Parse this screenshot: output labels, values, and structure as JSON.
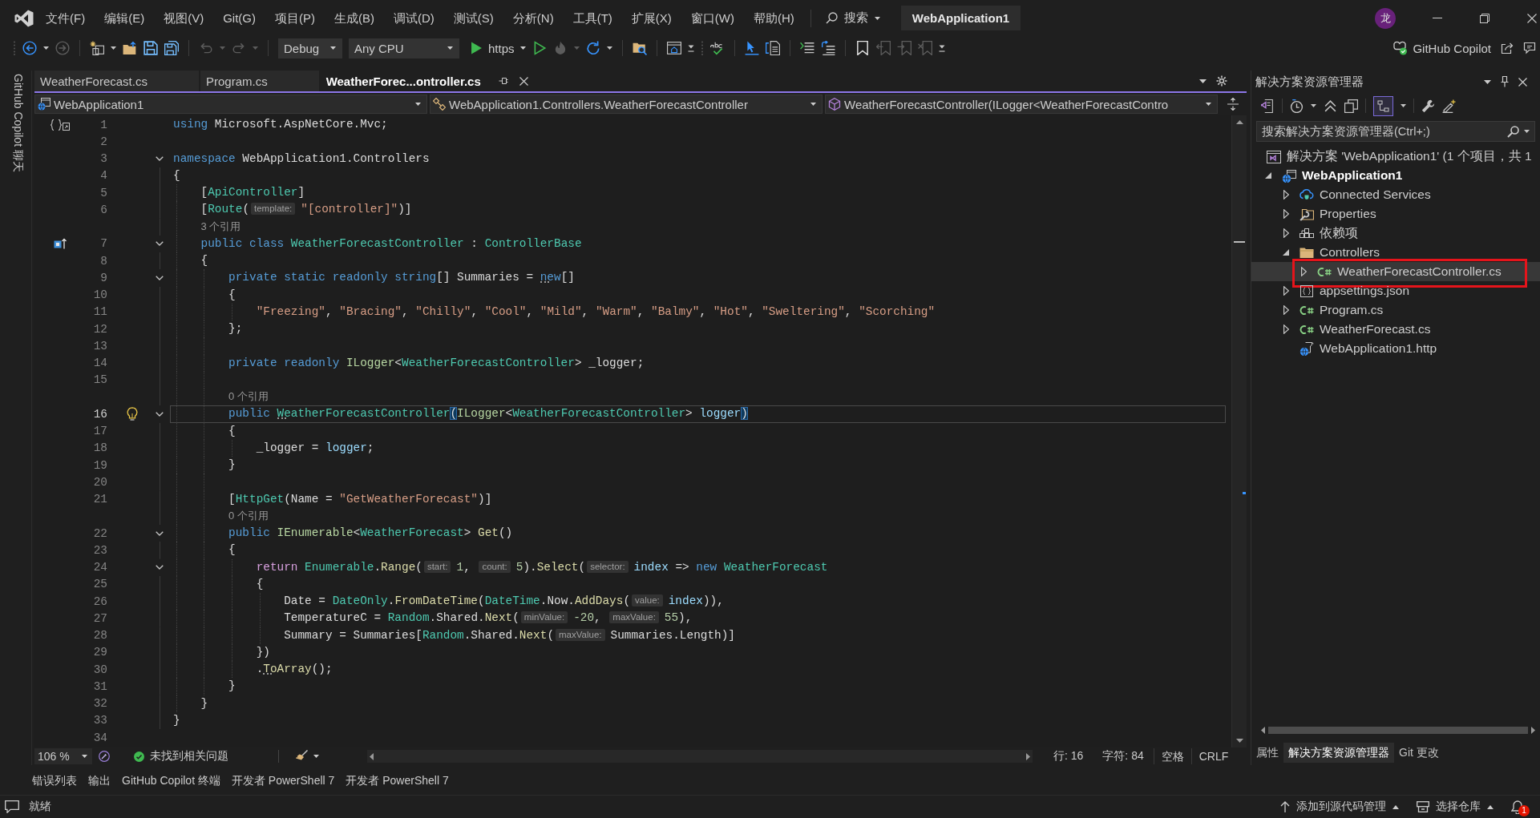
{
  "title_bar": {
    "menu": [
      "文件(F)",
      "编辑(E)",
      "视图(V)",
      "Git(G)",
      "项目(P)",
      "生成(B)",
      "调试(D)",
      "测试(S)",
      "分析(N)",
      "工具(T)",
      "扩展(X)",
      "窗口(W)",
      "帮助(H)"
    ],
    "search": "搜索",
    "title": "WebApplication1",
    "avatar": "龙"
  },
  "toolbar": {
    "items": [
      {
        "kind": "grip"
      },
      {
        "kind": "back",
        "disabled": false
      },
      {
        "kind": "caret",
        "disabled": false
      },
      {
        "kind": "forward",
        "disabled": true
      },
      {
        "kind": "sep"
      },
      {
        "kind": "newitem",
        "disabled": false
      },
      {
        "kind": "caret",
        "disabled": false
      },
      {
        "kind": "open",
        "disabled": false
      },
      {
        "kind": "save",
        "disabled": false
      },
      {
        "kind": "saveall",
        "disabled": false
      },
      {
        "kind": "sep"
      },
      {
        "kind": "undo",
        "disabled": true
      },
      {
        "kind": "caret",
        "disabled": true
      },
      {
        "kind": "redo",
        "disabled": true
      },
      {
        "kind": "caret",
        "disabled": true
      },
      {
        "kind": "sep"
      },
      {
        "kind": "configuration",
        "value": "Debug"
      },
      {
        "kind": "platform",
        "value": "Any CPU"
      },
      {
        "kind": "start",
        "label": "https"
      },
      {
        "kind": "run",
        "disabled": false
      },
      {
        "kind": "hotreload",
        "disabled": true
      },
      {
        "kind": "caret",
        "disabled": true
      },
      {
        "kind": "restart",
        "disabled": false
      },
      {
        "kind": "caret",
        "disabled": false
      },
      {
        "kind": "sep"
      },
      {
        "kind": "findfolder",
        "disabled": false
      },
      {
        "kind": "sep"
      },
      {
        "kind": "browser",
        "disabled": false
      },
      {
        "kind": "overflow"
      },
      {
        "kind": "grip"
      },
      {
        "kind": "spellcheck",
        "disabled": false
      },
      {
        "kind": "sep"
      },
      {
        "kind": "pointer",
        "disabled": false
      },
      {
        "kind": "document",
        "disabled": false
      },
      {
        "kind": "sep"
      },
      {
        "kind": "lines",
        "disabled": false
      },
      {
        "kind": "uncomment",
        "disabled": false
      },
      {
        "kind": "sep"
      },
      {
        "kind": "bookmark",
        "disabled": false
      },
      {
        "kind": "bookprev",
        "disabled": true
      },
      {
        "kind": "booknext",
        "disabled": true
      },
      {
        "kind": "bookclear",
        "disabled": true
      },
      {
        "kind": "overflow"
      }
    ],
    "copilot": "GitHub Copilot"
  },
  "side_panel": {
    "label": "GitHub Copilot 聊天"
  },
  "editor": {
    "tabs": [
      {
        "label": "WeatherForecast.cs",
        "selected": false
      },
      {
        "label": "Program.cs",
        "selected": false
      },
      {
        "label": "WeatherForec...ontroller.cs",
        "selected": true
      }
    ],
    "navigation": [
      {
        "kind": "project",
        "text": "WebApplication1"
      },
      {
        "kind": "class",
        "text": "WebApplication1.Controllers.WeatherForecastController"
      },
      {
        "kind": "method",
        "text": "WeatherForecastController(ILogger<WeatherForecastContro"
      }
    ],
    "lines": [
      {
        "kind": "code",
        "number": "1",
        "fold": false,
        "current": false,
        "glyph": {
          "kind": "scope"
        },
        "tokens": [
          {
            "kind": "keyword",
            "text": "using"
          },
          {
            "kind": "plain",
            "text": " Microsoft.AspNetCore.Mvc;"
          }
        ]
      },
      {
        "kind": "code",
        "number": "2",
        "fold": false,
        "current": false
      },
      {
        "kind": "code",
        "number": "3",
        "fold": true,
        "current": false,
        "tokens": [
          {
            "kind": "keyword",
            "text": "namespace"
          },
          {
            "kind": "plain",
            "text": " WebApplication1.Controllers"
          }
        ]
      },
      {
        "kind": "code",
        "number": "4",
        "fold": false,
        "current": false,
        "tokens": [
          {
            "kind": "plain",
            "text": "{"
          }
        ]
      },
      {
        "kind": "code",
        "number": "5",
        "fold": false,
        "current": false,
        "tokens": [
          {
            "kind": "plain",
            "text": "    ["
          },
          {
            "kind": "type",
            "text": "ApiController"
          },
          {
            "kind": "plain",
            "text": "]"
          }
        ]
      },
      {
        "kind": "code",
        "number": "6",
        "fold": false,
        "current": false,
        "tokens": [
          {
            "kind": "plain",
            "text": "    ["
          },
          {
            "kind": "type",
            "text": "Route"
          },
          {
            "kind": "plain",
            "text": "("
          },
          {
            "kind": "hint",
            "text": "template:"
          },
          {
            "kind": "string",
            "text": "\"[controller]\""
          },
          {
            "kind": "plain",
            "text": ")]"
          }
        ]
      },
      {
        "kind": "codelens",
        "text": "3 个引用"
      },
      {
        "kind": "code",
        "number": "7",
        "fold": true,
        "current": false,
        "glyph": {
          "kind": "implements"
        },
        "tokens": [
          {
            "kind": "keyword",
            "text": "    public class "
          },
          {
            "kind": "type",
            "text": "WeatherForecastController"
          },
          {
            "kind": "plain",
            "text": " : "
          },
          {
            "kind": "type",
            "text": "ControllerBase"
          }
        ]
      },
      {
        "kind": "code",
        "number": "8",
        "fold": false,
        "current": false,
        "tokens": [
          {
            "kind": "plain",
            "text": "    {"
          }
        ]
      },
      {
        "kind": "code",
        "number": "9",
        "fold": true,
        "current": false,
        "tokens": [
          {
            "kind": "keyword",
            "text": "        private static readonly string"
          },
          {
            "kind": "plain",
            "text": "[] Summaries = "
          },
          {
            "kind": "keyword",
            "text": "new",
            "dotted": true
          },
          {
            "kind": "plain",
            "text": "[]"
          }
        ]
      },
      {
        "kind": "code",
        "number": "10",
        "fold": false,
        "current": false,
        "tokens": [
          {
            "kind": "plain",
            "text": "        {"
          }
        ]
      },
      {
        "kind": "code",
        "number": "11",
        "fold": false,
        "current": false,
        "tokens": [
          {
            "kind": "string",
            "text": "            \"Freezing\""
          },
          {
            "kind": "plain",
            "text": ", "
          },
          {
            "kind": "string",
            "text": "\"Bracing\""
          },
          {
            "kind": "plain",
            "text": ", "
          },
          {
            "kind": "string",
            "text": "\"Chilly\""
          },
          {
            "kind": "plain",
            "text": ", "
          },
          {
            "kind": "string",
            "text": "\"Cool\""
          },
          {
            "kind": "plain",
            "text": ", "
          },
          {
            "kind": "string",
            "text": "\"Mild\""
          },
          {
            "kind": "plain",
            "text": ", "
          },
          {
            "kind": "string",
            "text": "\"Warm\""
          },
          {
            "kind": "plain",
            "text": ", "
          },
          {
            "kind": "string",
            "text": "\"Balmy\""
          },
          {
            "kind": "plain",
            "text": ", "
          },
          {
            "kind": "string",
            "text": "\"Hot\""
          },
          {
            "kind": "plain",
            "text": ", "
          },
          {
            "kind": "string",
            "text": "\"Sweltering\""
          },
          {
            "kind": "plain",
            "text": ", "
          },
          {
            "kind": "string",
            "text": "\"Scorching\""
          }
        ]
      },
      {
        "kind": "code",
        "number": "12",
        "fold": false,
        "current": false,
        "tokens": [
          {
            "kind": "plain",
            "text": "        };"
          }
        ]
      },
      {
        "kind": "code",
        "number": "13",
        "fold": false,
        "current": false
      },
      {
        "kind": "code",
        "number": "14",
        "fold": false,
        "current": false,
        "tokens": [
          {
            "kind": "keyword",
            "text": "        private readonly "
          },
          {
            "kind": "interface",
            "text": "ILogger"
          },
          {
            "kind": "plain",
            "text": "<"
          },
          {
            "kind": "type",
            "text": "WeatherForecastController"
          },
          {
            "kind": "plain",
            "text": "> _logger;"
          }
        ]
      },
      {
        "kind": "code",
        "number": "15",
        "fold": false,
        "current": false
      },
      {
        "kind": "codelens",
        "text": "0 个引用"
      },
      {
        "kind": "code",
        "number": "16",
        "fold": true,
        "current": true,
        "glyph": {
          "kind": "bulb"
        },
        "tokens": [
          {
            "kind": "keyword",
            "text": "        public "
          },
          {
            "kind": "type",
            "text": "WeatherForecastController",
            "dotted": true
          },
          {
            "kind": "plain",
            "text": "(",
            "match": true
          },
          {
            "kind": "interface",
            "text": "ILogger"
          },
          {
            "kind": "plain",
            "text": "<"
          },
          {
            "kind": "type",
            "text": "WeatherForecastController"
          },
          {
            "kind": "plain",
            "text": "> "
          },
          {
            "kind": "param",
            "text": "logger"
          },
          {
            "kind": "plain",
            "text": ")",
            "match": true
          }
        ]
      },
      {
        "kind": "code",
        "number": "17",
        "fold": false,
        "current": false,
        "tokens": [
          {
            "kind": "plain",
            "text": "        {"
          }
        ]
      },
      {
        "kind": "code",
        "number": "18",
        "fold": false,
        "current": false,
        "tokens": [
          {
            "kind": "plain",
            "text": "            _logger = "
          },
          {
            "kind": "param",
            "text": "logger"
          },
          {
            "kind": "plain",
            "text": ";"
          }
        ]
      },
      {
        "kind": "code",
        "number": "19",
        "fold": false,
        "current": false,
        "tokens": [
          {
            "kind": "plain",
            "text": "        }"
          }
        ]
      },
      {
        "kind": "code",
        "number": "20",
        "fold": false,
        "current": false
      },
      {
        "kind": "code",
        "number": "21",
        "fold": false,
        "current": false,
        "tokens": [
          {
            "kind": "plain",
            "text": "        ["
          },
          {
            "kind": "type",
            "text": "HttpGet"
          },
          {
            "kind": "plain",
            "text": "(Name = "
          },
          {
            "kind": "string",
            "text": "\"GetWeatherForecast\""
          },
          {
            "kind": "plain",
            "text": ")]"
          }
        ]
      },
      {
        "kind": "codelens",
        "text": "0 个引用"
      },
      {
        "kind": "code",
        "number": "22",
        "fold": true,
        "current": false,
        "tokens": [
          {
            "kind": "keyword",
            "text": "        public "
          },
          {
            "kind": "interface",
            "text": "IEnumerable"
          },
          {
            "kind": "plain",
            "text": "<"
          },
          {
            "kind": "type",
            "text": "WeatherForecast"
          },
          {
            "kind": "plain",
            "text": "> "
          },
          {
            "kind": "method",
            "text": "Get"
          },
          {
            "kind": "plain",
            "text": "()"
          }
        ]
      },
      {
        "kind": "code",
        "number": "23",
        "fold": false,
        "current": false,
        "tokens": [
          {
            "kind": "plain",
            "text": "        {"
          }
        ]
      },
      {
        "kind": "code",
        "number": "24",
        "fold": true,
        "current": false,
        "tokens": [
          {
            "kind": "control",
            "text": "            return "
          },
          {
            "kind": "type",
            "text": "Enumerable"
          },
          {
            "kind": "plain",
            "text": "."
          },
          {
            "kind": "method",
            "text": "Range"
          },
          {
            "kind": "plain",
            "text": "("
          },
          {
            "kind": "hint",
            "text": "start:"
          },
          {
            "kind": "number",
            "text": "1"
          },
          {
            "kind": "plain",
            "text": ", "
          },
          {
            "kind": "hint",
            "text": "count:"
          },
          {
            "kind": "number",
            "text": "5"
          },
          {
            "kind": "plain",
            "text": ")."
          },
          {
            "kind": "method",
            "text": "Select"
          },
          {
            "kind": "plain",
            "text": "("
          },
          {
            "kind": "hint",
            "text": "selector:"
          },
          {
            "kind": "param",
            "text": "index"
          },
          {
            "kind": "plain",
            "text": " => "
          },
          {
            "kind": "keyword",
            "text": "new "
          },
          {
            "kind": "type",
            "text": "WeatherForecast"
          }
        ]
      },
      {
        "kind": "code",
        "number": "25",
        "fold": false,
        "current": false,
        "tokens": [
          {
            "kind": "plain",
            "text": "            {"
          }
        ]
      },
      {
        "kind": "code",
        "number": "26",
        "fold": false,
        "current": false,
        "tokens": [
          {
            "kind": "plain",
            "text": "                Date = "
          },
          {
            "kind": "type",
            "text": "DateOnly"
          },
          {
            "kind": "plain",
            "text": "."
          },
          {
            "kind": "method",
            "text": "FromDateTime"
          },
          {
            "kind": "plain",
            "text": "("
          },
          {
            "kind": "type",
            "text": "DateTime"
          },
          {
            "kind": "plain",
            "text": ".Now."
          },
          {
            "kind": "method",
            "text": "AddDays"
          },
          {
            "kind": "plain",
            "text": "("
          },
          {
            "kind": "hint",
            "text": "value:"
          },
          {
            "kind": "param",
            "text": "index"
          },
          {
            "kind": "plain",
            "text": ")),"
          }
        ]
      },
      {
        "kind": "code",
        "number": "27",
        "fold": false,
        "current": false,
        "tokens": [
          {
            "kind": "plain",
            "text": "                TemperatureC = "
          },
          {
            "kind": "type",
            "text": "Random"
          },
          {
            "kind": "plain",
            "text": ".Shared."
          },
          {
            "kind": "method",
            "text": "Next"
          },
          {
            "kind": "plain",
            "text": "("
          },
          {
            "kind": "hint",
            "text": "minValue:"
          },
          {
            "kind": "number",
            "text": "-20"
          },
          {
            "kind": "plain",
            "text": ", "
          },
          {
            "kind": "hint",
            "text": "maxValue:"
          },
          {
            "kind": "number",
            "text": "55"
          },
          {
            "kind": "plain",
            "text": "),"
          }
        ]
      },
      {
        "kind": "code",
        "number": "28",
        "fold": false,
        "current": false,
        "tokens": [
          {
            "kind": "plain",
            "text": "                Summary = Summaries["
          },
          {
            "kind": "type",
            "text": "Random"
          },
          {
            "kind": "plain",
            "text": ".Shared."
          },
          {
            "kind": "method",
            "text": "Next"
          },
          {
            "kind": "plain",
            "text": "("
          },
          {
            "kind": "hint",
            "text": "maxValue:"
          },
          {
            "kind": "plain",
            "text": "Summaries.Length)]"
          }
        ]
      },
      {
        "kind": "code",
        "number": "29",
        "fold": false,
        "current": false,
        "tokens": [
          {
            "kind": "plain",
            "text": "            })"
          }
        ]
      },
      {
        "kind": "code",
        "number": "30",
        "fold": false,
        "current": false,
        "tokens": [
          {
            "kind": "plain",
            "text": "            ."
          },
          {
            "kind": "method",
            "text": "ToArray",
            "dotted": true
          },
          {
            "kind": "plain",
            "text": "();"
          }
        ]
      },
      {
        "kind": "code",
        "number": "31",
        "fold": false,
        "current": false,
        "tokens": [
          {
            "kind": "plain",
            "text": "        }"
          }
        ]
      },
      {
        "kind": "code",
        "number": "32",
        "fold": false,
        "current": false,
        "tokens": [
          {
            "kind": "plain",
            "text": "    }"
          }
        ]
      },
      {
        "kind": "code",
        "number": "33",
        "fold": false,
        "current": false,
        "tokens": [
          {
            "kind": "plain",
            "text": "}"
          }
        ]
      },
      {
        "kind": "code",
        "number": "34",
        "fold": false,
        "current": false
      }
    ],
    "status": {
      "zoom": "106 %",
      "issues": "未找到相关问题",
      "line": "行: 16",
      "column": "字符: 84",
      "indent": "空格",
      "eol": "CRLF"
    }
  },
  "solution_explorer": {
    "title": "解决方案资源管理器",
    "toolbar": [
      {
        "kind": "switchviews",
        "on": false
      },
      {
        "kind": "sep"
      },
      {
        "kind": "history",
        "on": false
      },
      {
        "kind": "caret"
      },
      {
        "kind": "collapse",
        "on": false
      },
      {
        "kind": "copies",
        "on": false
      },
      {
        "kind": "sep"
      },
      {
        "kind": "sync",
        "on": true
      },
      {
        "kind": "caret"
      },
      {
        "kind": "sep"
      },
      {
        "kind": "properties",
        "on": false
      },
      {
        "kind": "preview",
        "on": false
      }
    ],
    "search": {
      "placeholder": "搜索解决方案资源管理器(Ctrl+;)"
    },
    "tree": [
      {
        "kind": "solution",
        "label": "解决方案 'WebApplication1' (1 个项目，共 1",
        "selected": false,
        "boxed": false,
        "children": [
          {
            "kind": "project",
            "label": "WebApplication1",
            "expanded": true,
            "selected": false,
            "boxed": false,
            "children": [
              {
                "kind": "connected",
                "label": "Connected Services",
                "expanded": false,
                "selected": false,
                "boxed": false
              },
              {
                "kind": "properties",
                "label": "Properties",
                "expanded": false,
                "selected": false,
                "boxed": false
              },
              {
                "kind": "dependencies",
                "label": "依赖项",
                "expanded": false,
                "selected": false,
                "boxed": false
              },
              {
                "kind": "folder",
                "label": "Controllers",
                "expanded": true,
                "selected": false,
                "boxed": false,
                "children": [
                  {
                    "kind": "csharp",
                    "label": "WeatherForecastController.cs",
                    "expanded": false,
                    "selected": true,
                    "boxed": true
                  }
                ]
              },
              {
                "kind": "json",
                "label": "appsettings.json",
                "expanded": false,
                "selected": false,
                "boxed": false
              },
              {
                "kind": "csharp",
                "label": "Program.cs",
                "expanded": false,
                "selected": false,
                "boxed": false
              },
              {
                "kind": "csharp",
                "label": "WeatherForecast.cs",
                "expanded": false,
                "selected": false,
                "boxed": false
              },
              {
                "kind": "http",
                "label": "WebApplication1.http",
                "selected": false,
                "boxed": false
              }
            ]
          }
        ]
      }
    ],
    "tabs": [
      {
        "label": "属性",
        "selected": false
      },
      {
        "label": "解决方案资源管理器",
        "selected": true
      },
      {
        "label": "Git 更改",
        "selected": false
      }
    ]
  },
  "tool_tabs": [
    "错误列表",
    "输出",
    "GitHub Copilot 终端",
    "开发者 PowerShell 7",
    "开发者 PowerShell 7"
  ],
  "status_bar": {
    "state": "就绪",
    "source_control": "添加到源代码管理",
    "repository": "选择仓库",
    "notifications": "1"
  }
}
